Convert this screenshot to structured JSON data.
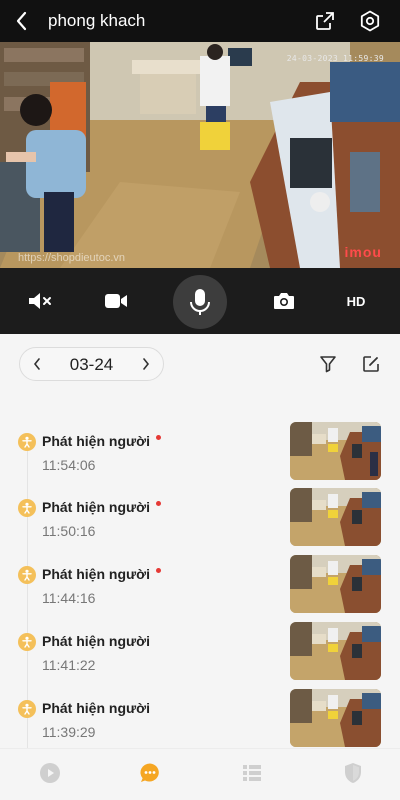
{
  "header": {
    "title": "phong khach",
    "back_icon": "chevron-left-icon",
    "share_icon": "share-icon",
    "settings_icon": "settings-icon"
  },
  "video": {
    "timestamp": "24-03-2023 11:59:39",
    "watermark": "https://shopdieutoc.vn",
    "logo_text": "imou"
  },
  "controls": {
    "mute_icon": "speaker-muted-icon",
    "record_icon": "video-camera-icon",
    "mic_icon": "microphone-icon",
    "snapshot_icon": "camera-icon",
    "quality_label": "HD"
  },
  "datebar": {
    "date": "03-24",
    "prev_label": "‹",
    "next_label": "›",
    "filter_icon": "filter-icon",
    "edit_icon": "edit-icon"
  },
  "events": [
    {
      "title": "Phát hiện người",
      "time": "11:54:06",
      "unread": true
    },
    {
      "title": "Phát hiện người",
      "time": "11:50:16",
      "unread": true
    },
    {
      "title": "Phát hiện người",
      "time": "11:44:16",
      "unread": true
    },
    {
      "title": "Phát hiện người",
      "time": "11:41:22",
      "unread": false
    },
    {
      "title": "Phát hiện người",
      "time": "11:39:29",
      "unread": false
    }
  ],
  "bottom_nav": [
    {
      "icon": "play-icon",
      "active": false
    },
    {
      "icon": "message-icon",
      "active": true
    },
    {
      "icon": "list-icon",
      "active": false
    },
    {
      "icon": "shield-icon",
      "active": false
    }
  ],
  "colors": {
    "accent": "#f5a623",
    "unread_dot": "#e53935",
    "event_icon": "#f4c05a"
  }
}
